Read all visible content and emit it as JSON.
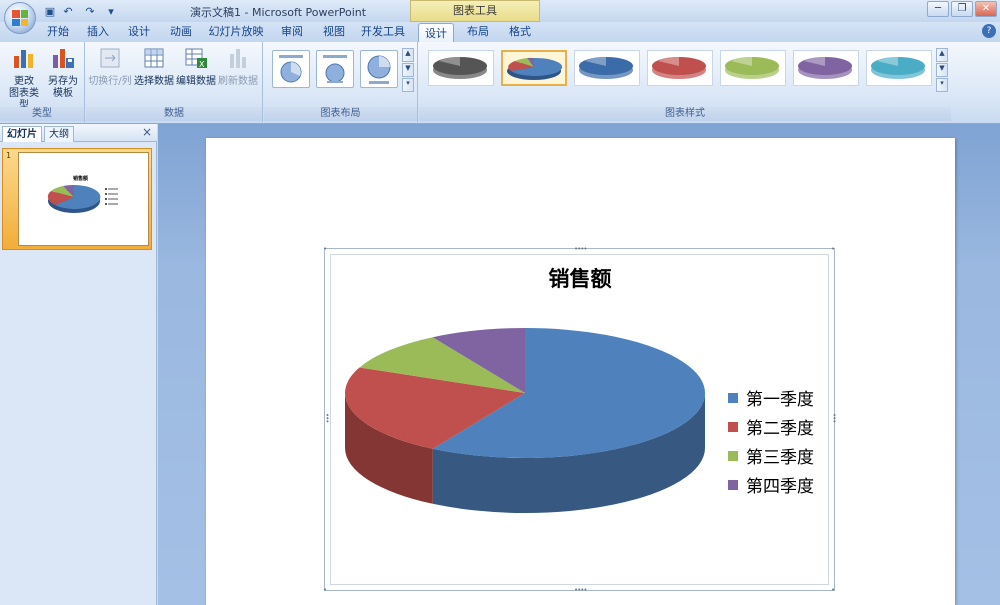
{
  "window": {
    "title": "演示文稿1 - Microsoft PowerPoint",
    "context_tool": "图表工具"
  },
  "ribbon_tabs": [
    "开始",
    "插入",
    "设计",
    "动画",
    "幻灯片放映",
    "审阅",
    "视图",
    "开发工具",
    "设计",
    "布局",
    "格式"
  ],
  "active_tab": "设计",
  "groups": {
    "type": {
      "label": "类型",
      "change_type": [
        "更改",
        "图表类型"
      ],
      "save_template": [
        "另存为",
        "模板"
      ]
    },
    "data": {
      "label": "数据",
      "switch_row_col": "切换行/列",
      "select_data": "选择数据",
      "edit_data": "编辑数据",
      "refresh_data": "刷新数据"
    },
    "layout": {
      "label": "图表布局"
    },
    "styles": {
      "label": "图表样式"
    }
  },
  "style_colors": [
    "#555555",
    "#4f81bd",
    "#3b6ba8",
    "#c0504d",
    "#9bbb59",
    "#8064a2",
    "#4bacc6"
  ],
  "panel": {
    "tab_slides": "幻灯片",
    "tab_outline": "大纲",
    "close": "×",
    "slide_number": "1"
  },
  "thumbnail": {
    "title": "销售额"
  },
  "chart_data": {
    "type": "pie",
    "title": "销售额",
    "categories": [
      "第一季度",
      "第二季度",
      "第三季度",
      "第四季度"
    ],
    "values": [
      8.2,
      3.2,
      1.4,
      1.2
    ],
    "colors": [
      "#4f81bd",
      "#c0504d",
      "#9bbb59",
      "#8064a2"
    ],
    "legend_position": "right"
  }
}
